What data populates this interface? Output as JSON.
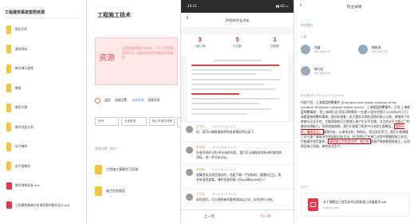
{
  "panel1": {
    "title": "工程建筑事故案例资源",
    "files": [
      {
        "label": "相关文件",
        "type": "folder"
      },
      {
        "label": "案例资料",
        "type": "folder"
      },
      {
        "label": "教学演示视频",
        "type": "folder"
      },
      {
        "label": "教案",
        "type": "folder"
      },
      {
        "label": "教学大纲",
        "type": "folder"
      },
      {
        "label": "教学进度计划",
        "type": "folder"
      },
      {
        "label": "电子教材",
        "type": "folder"
      },
      {
        "label": "电子版教材",
        "type": "folder"
      },
      {
        "label": "教学课程标准.doc",
        "type": "file"
      },
      {
        "label": "工程建筑事故分析课程案例整合设计.pdf",
        "type": "file"
      }
    ]
  },
  "panel2": {
    "title": "工程施工技术",
    "banner_mark": "资源",
    "banner_text": "这里是案例教学资源库，可以上传资源相关文件，请保持资源的完整性和准确性",
    "toolbar": {
      "back": "返回",
      "current": "当前位置:",
      "link1": "全部资源",
      "link2": "资源分类"
    },
    "selects": [
      "所有",
      "全部类型",
      "输入关键字搜索"
    ],
    "section_label": "资源分类 · 共2个",
    "folders": [
      "工程施工事故学习资源",
      "施工危险规范"
    ]
  },
  "panel3": {
    "status_time": "20:23",
    "status_icons": "▮▮ 4G ▭",
    "nav_title": "29组的作业讨论",
    "stats": [
      {
        "value": "3",
        "label": "小组人数"
      },
      {
        "value": "5",
        "label": "讨论数"
      },
      {
        "value": "1",
        "label": "回帖数"
      }
    ],
    "comments": [
      {
        "name": "王子佳",
        "time": "2019-03-03 14:22",
        "text": "好，我可以做根据老师的讲述做好的记录了。"
      },
      {
        "name": "朱永娟",
        "time": "2019-03-03 14:23",
        "text": "在老师讲的1到5中分析的内容，我们可以根据老师所讲的查找的资料，进一步分析讨论。"
      },
      {
        "name": "朱永娟",
        "time": "2019-03-03 14:25",
        "text": "就算是安全规范很好的，也要下载一手材料的，整理好之后，再发给老师查看，课件里面的第二份ppt第66,66页!!!"
      },
      {
        "name": "王子佳",
        "time": "2019-03-03 14:30",
        "text": "现在我们，可以把原来的案例再加以讨论，好好进行小结。"
      }
    ],
    "prev": "上一页",
    "next": "下一页"
  },
  "panel4": {
    "back": "‹",
    "title": "作业详情",
    "note": "作业得分",
    "group_label": "小组",
    "members": [
      {
        "name": "李鑫",
        "id": "6612840131"
      },
      {
        "name": "郭晓清",
        "id": "6612840135"
      },
      {
        "name": "郭元松",
        "id": "6612840130"
      }
    ],
    "submit_time": "作业提交于 2019-04-09 15:50:51",
    "content_head": "内容介绍：上海楼盘倒覆事件 (Shanghai real estate collapse of the incident; Shanghai collapse estate event)：上海楼盘倒覆事件。又名'上海楼盘倒覆事故'，是上海闵行区'莲花河畔景苑'一在建13层住宅楼于2009年6月27日清晨整体倒覆的事故。据分析调查，由于楼房北侧在短期内堆土过高，南侧地下车库基坑正在开挖，大楼两侧的压力差使土体产生水平位移，过大的水平力超过了桩基的抗侧能力，导致房屋倾倒。我们小组看了相关PPT内容主要概括，",
    "content_hl1": "案例分析，事故经过，",
    "content_mid": "整体分析，从现场分析，和结论，经过这次学习，我们小组掌握了对于整个事故发生原因的分析方法，并且明白了在施工过程中要确保施工安全，严格遵守规范要求，",
    "content_hl2": "确保施工时的安全性，施工时",
    "content_tail": "需要严格按照图纸施工，必须保证施工质量，做到安全生产。",
    "counter": "2/9个",
    "attachment_name": "关于钢筋加工规范技术应用和施工质量要求.pdf",
    "attachment_status": "Invalid date"
  }
}
